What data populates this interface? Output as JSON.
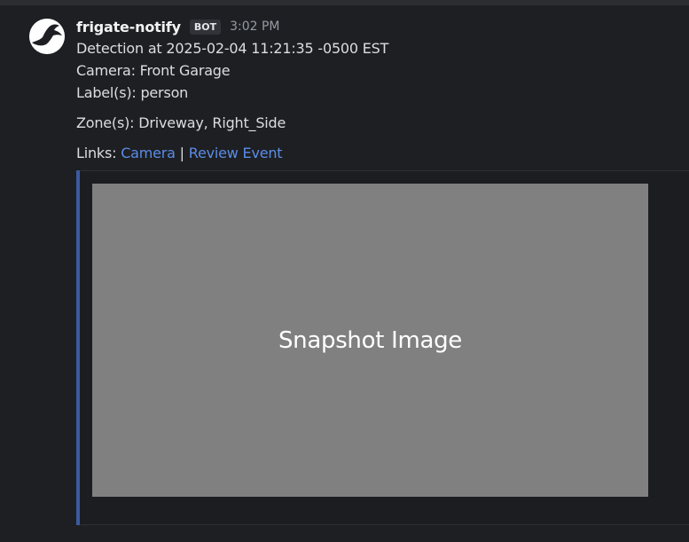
{
  "message": {
    "username": "frigate-notify",
    "badge": "BOT",
    "timestamp": "3:02 PM",
    "lines": {
      "detection": "Detection at 2025-02-04 11:21:35 -0500 EST",
      "camera": "Camera: Front Garage",
      "labels": "Label(s): person",
      "zones": "Zone(s): Driveway, Right_Side"
    },
    "links": {
      "prefix": "Links:",
      "camera_link": "Camera",
      "separator": "|",
      "review_link": "Review Event"
    },
    "embed": {
      "image_text": "Snapshot Image",
      "accent_color": "#3b5aa0",
      "image_bg": "#808080"
    }
  },
  "colors": {
    "background": "#1e1f22",
    "link": "#5a8de8",
    "text": "#dbdee1",
    "muted": "#949ba4"
  },
  "icons": {
    "avatar": "frigate-bird-icon"
  }
}
